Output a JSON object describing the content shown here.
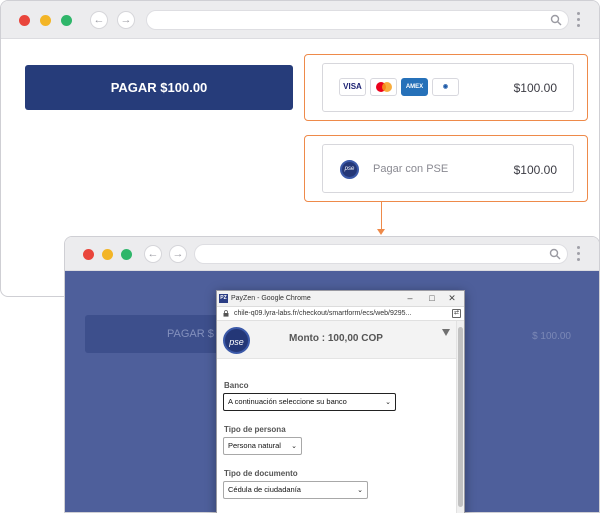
{
  "browser_main": {
    "pay_button_label": "PAGAR $100.00",
    "card_option": {
      "logos": [
        "VISA",
        "MC",
        "AMEX",
        "Diners"
      ],
      "amount": "$100.00"
    },
    "pse_option": {
      "logo_text": "pse",
      "label": "Pagar con PSE",
      "amount": "$100.00"
    }
  },
  "browser_overlay": {
    "ghost_button_label": "PAGAR $",
    "ghost_amount": "$ 100.00"
  },
  "popup": {
    "window_title": "PayZen - Google Chrome",
    "favicon_text": "PZ",
    "url": "chile-q09.lyra-labs.fr/checkout/smartform/ecs/web/9295...",
    "logo_text": "pse",
    "monto": "Monto : 100,00 COP",
    "fields": {
      "banco_label": "Banco",
      "banco_value": "A continuación seleccione su banco",
      "persona_label": "Tipo de persona",
      "persona_value": "Persona natural",
      "documento_label": "Tipo de documento",
      "documento_value": "Cédula de ciudadanía"
    }
  },
  "colors": {
    "brand_navy": "#263c7a",
    "highlight_orange": "#ee8a4a",
    "overlay_blue": "#4e5f9b",
    "dot_red": "#e9453c",
    "dot_yellow": "#f3b526",
    "dot_green": "#2fb66a"
  }
}
